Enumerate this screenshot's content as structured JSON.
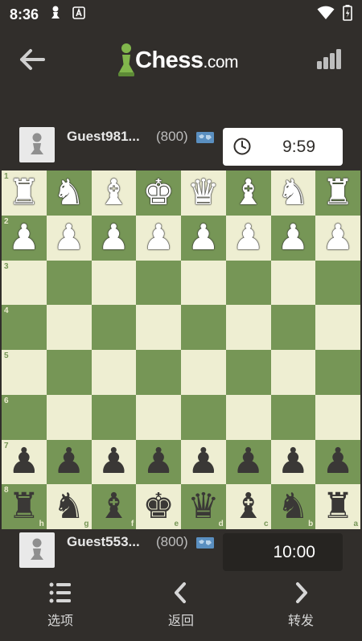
{
  "status_bar": {
    "time": "8:36"
  },
  "header": {
    "logo_text": "Chess",
    "logo_suffix": ".com"
  },
  "players": {
    "top": {
      "name": "Guest981...",
      "rating": "(800)",
      "clock": "9:59",
      "clock_active": true
    },
    "bottom": {
      "name": "Guest553...",
      "rating": "(800)",
      "clock": "10:00",
      "clock_active": false
    }
  },
  "board": {
    "rank_labels": [
      "1",
      "2",
      "3",
      "4",
      "5",
      "6",
      "7",
      "8"
    ],
    "file_labels": [
      "h",
      "g",
      "f",
      "e",
      "d",
      "c",
      "b",
      "a"
    ],
    "rows": [
      [
        "wR",
        "wN",
        "wB",
        "wK",
        "wQ",
        "wB",
        "wN",
        "wR"
      ],
      [
        "wP",
        "wP",
        "wP",
        "wP",
        "wP",
        "wP",
        "wP",
        "wP"
      ],
      [
        "",
        "",
        "",
        "",
        "",
        "",
        "",
        ""
      ],
      [
        "",
        "",
        "",
        "",
        "",
        "",
        "",
        ""
      ],
      [
        "",
        "",
        "",
        "",
        "",
        "",
        "",
        ""
      ],
      [
        "",
        "",
        "",
        "",
        "",
        "",
        "",
        ""
      ],
      [
        "bP",
        "bP",
        "bP",
        "bP",
        "bP",
        "bP",
        "bP",
        "bP"
      ],
      [
        "bR",
        "bN",
        "bB",
        "bK",
        "bQ",
        "bB",
        "bN",
        "bR"
      ]
    ]
  },
  "bottom_nav": {
    "options_label": "选项",
    "back_label": "返回",
    "forward_label": "转发"
  },
  "colors": {
    "light_square": "#eeeed2",
    "dark_square": "#769656",
    "background": "#312e2b",
    "logo_pawn": "#81b64c"
  }
}
